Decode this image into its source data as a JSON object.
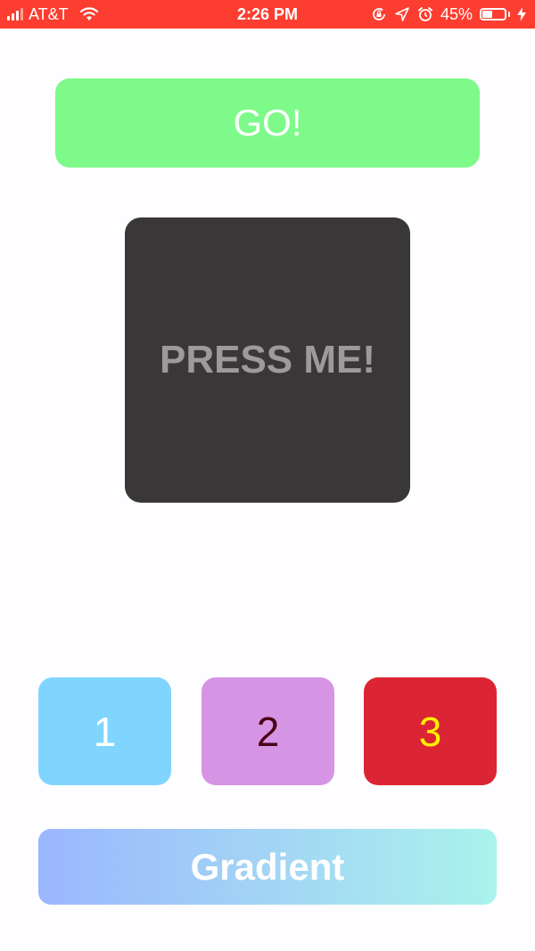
{
  "status_bar": {
    "carrier": "AT&T",
    "time": "2:26 PM",
    "battery_percent": "45%",
    "battery_level": 0.45,
    "background_color": "#fc3d2f",
    "icons": [
      "signal-icon",
      "wifi-icon",
      "rotation-lock-icon",
      "location-arrow-icon",
      "alarm-icon",
      "battery-icon",
      "charging-bolt-icon"
    ]
  },
  "buttons": {
    "go_label": "GO!",
    "press_label": "PRESS ME!",
    "one_label": "1",
    "two_label": "2",
    "three_label": "3",
    "gradient_label": "Gradient"
  },
  "colors": {
    "go_background": "#7efa8a",
    "press_background": "#3a3739",
    "press_text": "#9d9a9d",
    "one_background": "#80d5fe",
    "two_background": "#d694e4",
    "two_text": "#4a0014",
    "three_background": "#dc2534",
    "three_text": "#fef101",
    "gradient_start": "#9bb6fe",
    "gradient_end": "#aaf3ec",
    "page_background": "#fefdff"
  }
}
